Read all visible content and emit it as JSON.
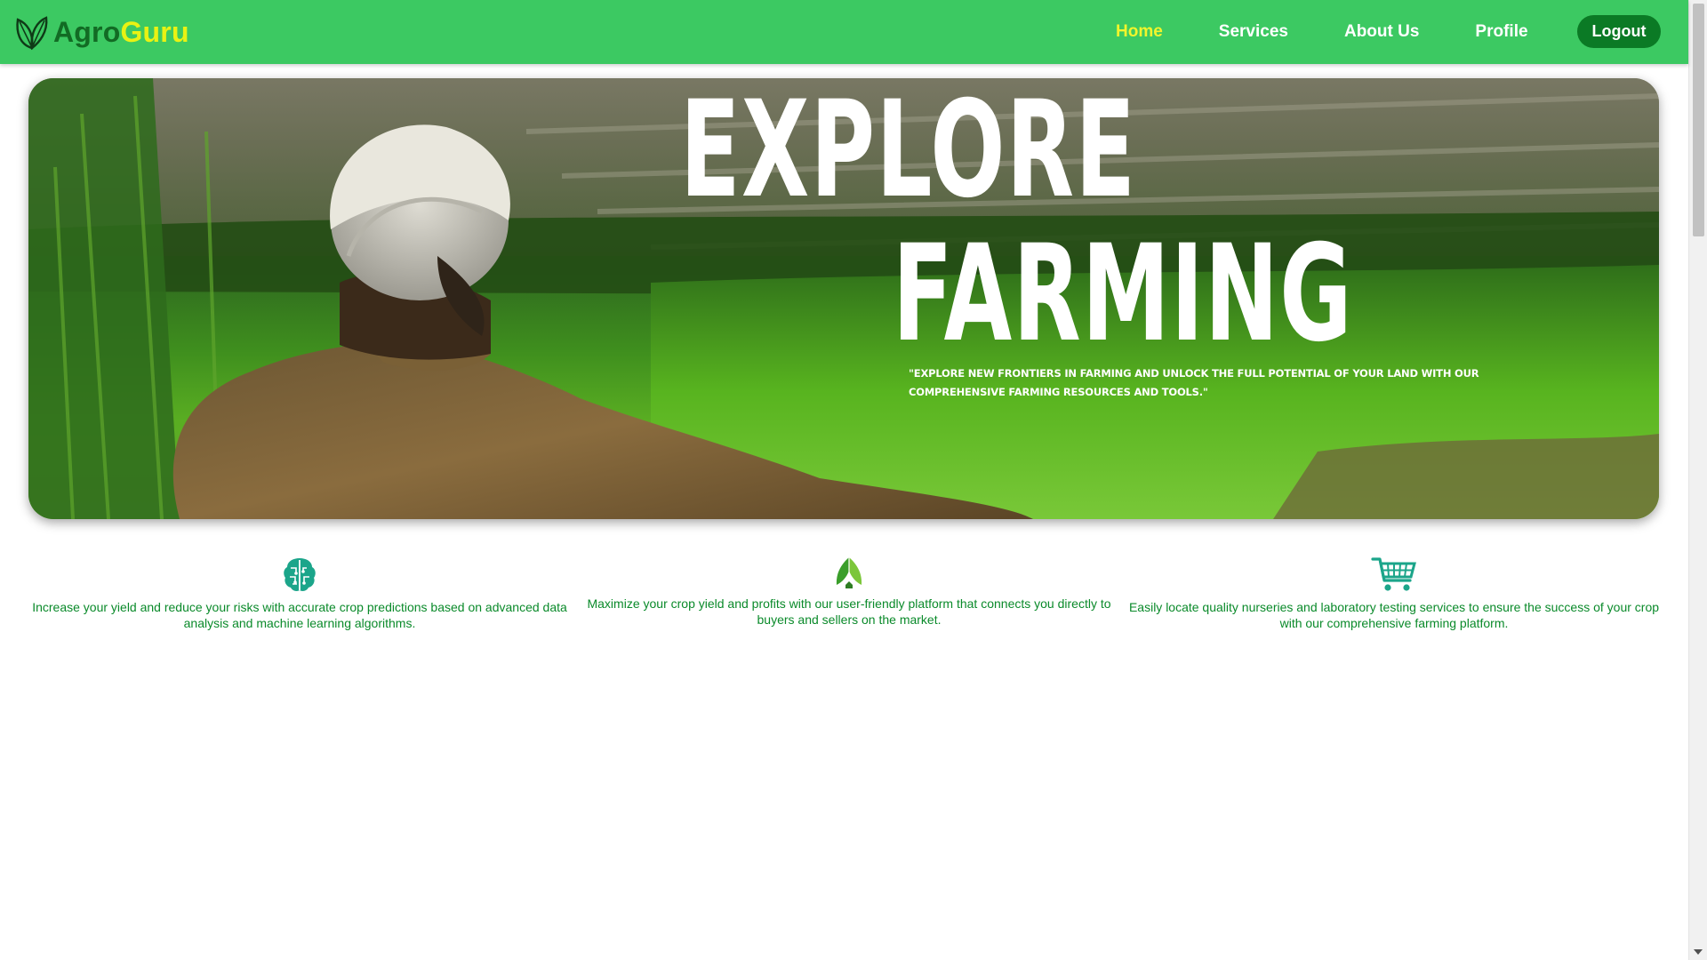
{
  "brand": {
    "name_part1": "Agro",
    "name_part2": "Guru",
    "icon": "leaf-logo-icon"
  },
  "nav": {
    "links": [
      {
        "label": "Home",
        "active": true
      },
      {
        "label": "Services",
        "active": false
      },
      {
        "label": "About Us",
        "active": false
      },
      {
        "label": "Profile",
        "active": false
      }
    ],
    "logout_label": "Logout"
  },
  "hero": {
    "title_line1": "EXPLORE",
    "title_line2": "FARMING",
    "quote": "\"Explore new frontiers in farming and unlock the full potential of your land with our comprehensive farming resources and tools.\"",
    "image": "farmer-in-rice-field-photo"
  },
  "features": [
    {
      "icon": "brain-circuit-icon",
      "text": "Increase your yield and reduce your risks with accurate crop predictions based on advanced data analysis and machine learning algorithms."
    },
    {
      "icon": "leaf-house-icon",
      "text": "Maximize your crop yield and profits with our user-friendly platform that connects you directly to buyers and sellers on the market."
    },
    {
      "icon": "shopping-cart-icon",
      "text": "Easily locate quality nurseries and laboratory testing services to ensure the success of your crop with our comprehensive farming platform."
    }
  ],
  "colors": {
    "navbar_bg": "#3cc962",
    "brand_dark": "#126b24",
    "brand_light": "#e9f213",
    "active_link": "#f2f52c",
    "logout_bg": "#0b7a25",
    "feature_text": "#0a8a2a",
    "icon_teal": "#1ba58a"
  }
}
